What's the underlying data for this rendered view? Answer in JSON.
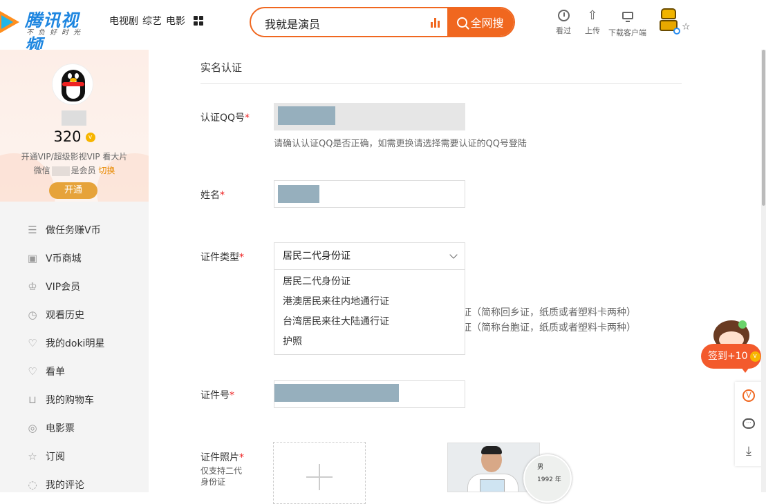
{
  "brand": {
    "title": "腾讯视频",
    "slogan": "不负好时光"
  },
  "topnav": {
    "items": [
      "电视剧",
      "综艺",
      "电影"
    ]
  },
  "search": {
    "value": "我就是演员",
    "button_label": "全网搜"
  },
  "toolbar": {
    "history_label": "看过",
    "upload_label": "上传",
    "download_label": "下载客户端"
  },
  "profile": {
    "points": "320",
    "coin_glyph": "v",
    "vip_promo": "开通VIP/超级影视VIP 看大片",
    "wechat_prefix": "微信",
    "wechat_suffix": "是会员",
    "switch_label": "切换",
    "open_label": "开通"
  },
  "sidebar": {
    "items": [
      {
        "label": "做任务赚V币",
        "icon": "task-list-icon"
      },
      {
        "label": "V币商城",
        "icon": "vcoin-bag-icon"
      },
      {
        "label": "VIP会员",
        "icon": "vip-crown-icon"
      },
      {
        "label": "观看历史",
        "icon": "clock-icon"
      },
      {
        "label": "我的doki明星",
        "icon": "heart-icon"
      },
      {
        "label": "看单",
        "icon": "heart-list-icon"
      },
      {
        "label": "我的购物车",
        "icon": "cart-icon"
      },
      {
        "label": "电影票",
        "icon": "ticket-icon"
      },
      {
        "label": "订阅",
        "icon": "star-icon"
      },
      {
        "label": "我的评论",
        "icon": "comment-icon"
      }
    ]
  },
  "form": {
    "page_title": "实名认证",
    "qq_label": "认证QQ号",
    "qq_hint": "请确认认证QQ是否正确，如需更换请选择需要认证的QQ号登陆",
    "name_label": "姓名",
    "id_type_label": "证件类型",
    "id_type_selected": "居民二代身份证",
    "id_type_options": [
      "居民二代身份证",
      "港澳居民来往内地通行证",
      "台湾居民来往大陆通行证",
      "护照"
    ],
    "behind_text_1": "证（简称回乡证，纸质或者塑料卡两种）",
    "behind_text_2": "证（简称台胞证，纸质或者塑料卡两种）",
    "id_number_label": "证件号",
    "photo_label": "证件照片",
    "photo_note": "仅支持二代身份证",
    "required_mark": "*"
  },
  "sample_card": {
    "line1": "男",
    "line2": "1992 年"
  },
  "signin": {
    "label": "签到+10"
  },
  "colors": {
    "accent": "#f0671f",
    "required": "#e22222",
    "vip_gold": "#e6a33a"
  }
}
